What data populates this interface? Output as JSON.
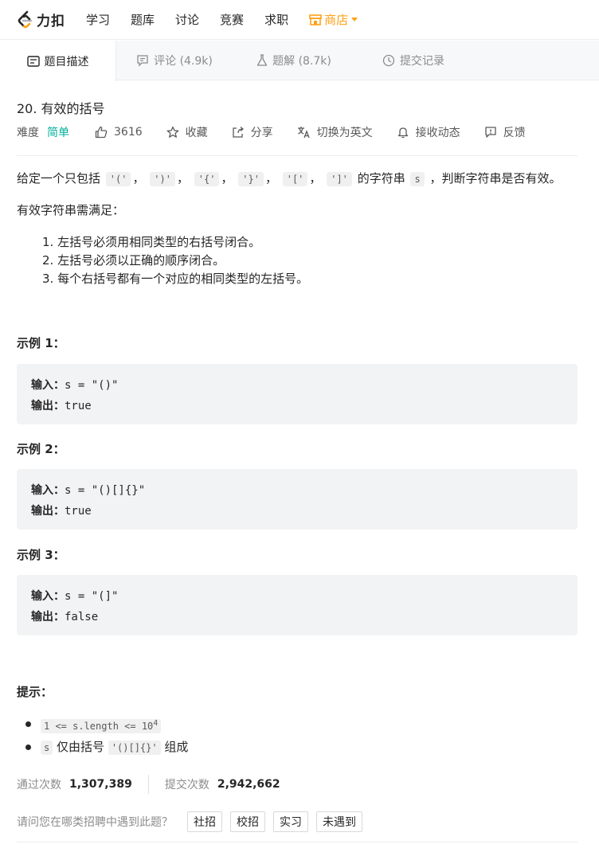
{
  "nav": {
    "logo_text": "力扣",
    "items": [
      "学习",
      "题库",
      "讨论",
      "竞赛",
      "求职"
    ],
    "store_label": "商店",
    "accent": "#ffa116"
  },
  "tabs": {
    "description": "题目描述",
    "discussion": "评论 (4.9k)",
    "solution": "题解 (8.7k)",
    "submissions": "提交记录"
  },
  "problem": {
    "title": "20. 有效的括号",
    "difficulty_label": "难度",
    "difficulty": "简单",
    "difficulty_color": "#00af9b",
    "likes": "3616",
    "favorite": "收藏",
    "share": "分享",
    "switch_lang": "切换为英文",
    "notify": "接收动态",
    "feedback": "反馈"
  },
  "description": {
    "intro_prefix": "给定一个只包括",
    "chars": [
      "'('",
      "')'",
      "'{'",
      "'}'",
      "'['",
      "']'"
    ],
    "sep": "，",
    "intro_mid": "的字符串",
    "var_s": "s",
    "intro_suffix": "，判断字符串是否有效。",
    "valid_intro": "有效字符串需满足：",
    "rules": [
      "1. 左括号必须用相同类型的右括号闭合。",
      "2. 左括号必须以正确的顺序闭合。",
      "3. 每个右括号都有一个对应的相同类型的左括号。"
    ]
  },
  "examples": [
    {
      "title": "示例 1：",
      "input_label": "输入：",
      "input": "s = \"()\"",
      "output_label": "输出：",
      "output": "true"
    },
    {
      "title": "示例 2：",
      "input_label": "输入：",
      "input": "s = \"()[]{}\"",
      "output_label": "输出：",
      "output": "true"
    },
    {
      "title": "示例 3：",
      "input_label": "输入：",
      "input": "s = \"(]\"",
      "output_label": "输出：",
      "output": "false"
    }
  ],
  "hints": {
    "title": "提示：",
    "h1_code": "1 <= s.length <= 10",
    "h1_sup": "4",
    "h2_code": "s",
    "h2_text": "仅由括号",
    "h2_code2": "'()[]{}'",
    "h2_suffix": "组成"
  },
  "stats": {
    "accepted_label": "通过次数",
    "accepted": "1,307,389",
    "submitted_label": "提交次数",
    "submitted": "2,942,662"
  },
  "survey": {
    "question": "请问您在哪类招聘中遇到此题？",
    "options": [
      "社招",
      "校招",
      "实习",
      "未遇到"
    ]
  }
}
